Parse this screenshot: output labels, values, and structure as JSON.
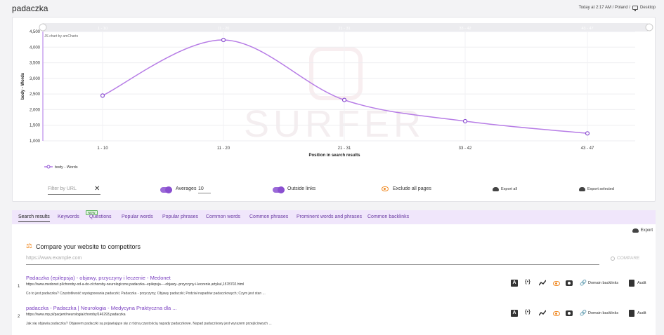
{
  "header": {
    "title": "padaczka",
    "context": "Today at 2:17 AM / Poland /",
    "device": "Desktop"
  },
  "chart_data": {
    "type": "line",
    "categories": [
      "1 - 10",
      "11 - 20",
      "21 - 31",
      "33 - 42",
      "43 - 47"
    ],
    "series": [
      {
        "name": "body - Words",
        "values": [
          2450,
          4230,
          2310,
          1630,
          1240
        ]
      }
    ],
    "xlabel": "Position in search results",
    "ylabel": "body - Words",
    "yticks": [
      "4,500",
      "4,000",
      "3,500",
      "3,000",
      "2,500",
      "2,000",
      "1,500",
      "1,000"
    ],
    "ylim": [
      1000,
      4500
    ],
    "credit": "JS chart by amCharts",
    "watermark": "SURFER",
    "grid": true,
    "legend": "bottom-left",
    "color": "#b77de6"
  },
  "controls": {
    "filter_placeholder": "Filter by URL",
    "clear": "✕",
    "averages_label": "Averages",
    "averages_value": "10",
    "outside_links_label": "Outside links",
    "exclude_all_label": "Exclude all pages",
    "export_all": "Export all",
    "export_selected": "Export selected"
  },
  "tabs": [
    {
      "label": "Search results",
      "active": true
    },
    {
      "label": "Keywords",
      "badge": "NEW"
    },
    {
      "label": "Questions"
    },
    {
      "label": "Popular words"
    },
    {
      "label": "Popular phrases"
    },
    {
      "label": "Common words"
    },
    {
      "label": "Common phrases"
    },
    {
      "label": "Prominent words and phrases"
    },
    {
      "label": "Common backlinks"
    }
  ],
  "results": {
    "export_label": "Export",
    "compare_title": "Compare your website to competitors",
    "url_placeholder": "https://www.example.com",
    "compare_button": "COMPARE",
    "domain_backlinks_label": "Domain backlinks",
    "audit_label": "Audit",
    "rows": [
      {
        "rank": "1",
        "title": "Padaczka (epilepsja) - objawy, przyczyny i leczenie - Medonet",
        "url": "https://www.medonet.pl/choroby-od-a-do-z/choroby-neurologiczne,padaczka--epilepsja----objawy--przyczyny-i-leczenie,artykul,1578702.html",
        "snippet": "Co to jest padaczka? Częstotliwość występowania padaczki; Padaczka - przyczyny; Objawy padaczki; Podział napadów padaczkowych; Czym jest stan ..."
      },
      {
        "rank": "2",
        "title": "padaczka - Padaczka | Neurologia - Medycyna Praktyczna dla ...",
        "url": "https://www.mp.pl/pacjent/neurologia/choroby/146293,padaczka",
        "snippet": "Jak się objawia padaczka? Objawem padaczki są pojawiające się z różną częstością napady padaczkowe. Napad padaczkowy jest wyrazem przejściowych ..."
      }
    ]
  }
}
